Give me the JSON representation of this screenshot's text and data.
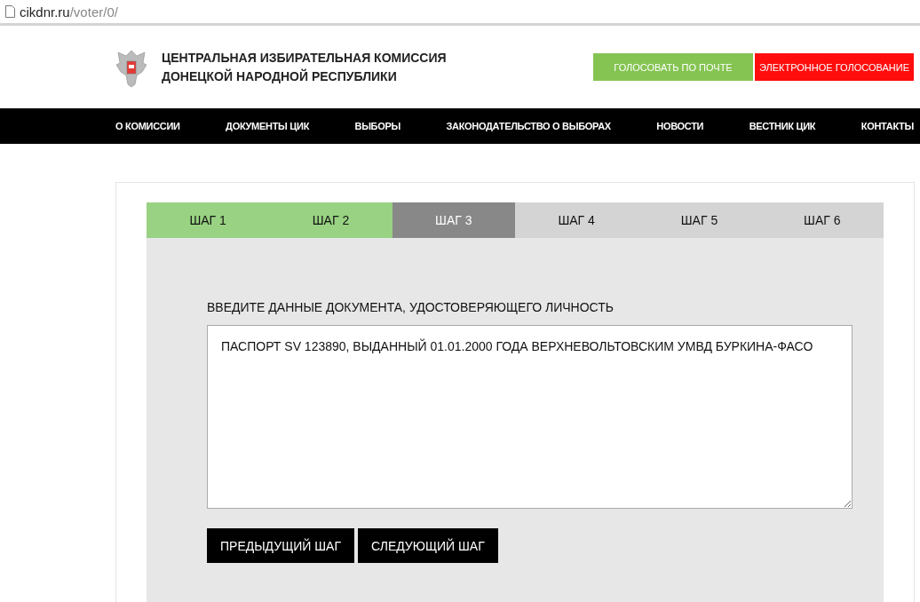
{
  "address_bar": {
    "domain": "cikdnr.ru",
    "path": "/voter/0/"
  },
  "header": {
    "title_lines": [
      "ЦЕНТРАЛЬНАЯ ИЗБИРАТЕЛЬНАЯ КОМИССИЯ",
      "ДОНЕЦКОЙ НАРОДНОЙ РЕСПУБЛИКИ"
    ],
    "buttons": [
      {
        "label": "ГОЛОСОВАТЬ ПО ПОЧТЕ",
        "kind": "mail"
      },
      {
        "label": "ЭЛЕКТРОННОЕ ГОЛОСОВАНИЕ",
        "kind": "electronic"
      }
    ]
  },
  "nav": [
    "О КОМИССИИ",
    "ДОКУМЕНТЫ ЦИК",
    "ВЫБОРЫ",
    "ЗАКОНОДАТЕЛЬСТВО О ВЫБОРАХ",
    "НОВОСТИ",
    "ВЕСТНИК ЦИК",
    "КОНТАКТЫ"
  ],
  "steps": [
    {
      "label": "ШАГ 1",
      "completed": true,
      "selected": false
    },
    {
      "label": "ШАГ 2",
      "completed": true,
      "selected": false
    },
    {
      "label": "ШАГ 3",
      "completed": false,
      "selected": true
    },
    {
      "label": "ШАГ 4",
      "completed": false,
      "selected": false
    },
    {
      "label": "ШАГ 5",
      "completed": false,
      "selected": false
    },
    {
      "label": "ШАГ 6",
      "completed": false,
      "selected": false
    }
  ],
  "form": {
    "label": "ВВЕДИТЕ ДАННЫЕ ДОКУМЕНТА, УДОСТОВЕРЯЮЩЕГО ЛИЧНОСТЬ",
    "value": "ПАСПОРТ SV 123890, ВЫДАННЫЙ 01.01.2000 ГОДА ВЕРХНЕВОЛЬТОВСКИМ УМВД БУРКИНА-ФАСО"
  },
  "actions": [
    "ПРЕДЫДУЩИЙ ШАГ",
    "СЛЕДУЮЩИЙ ШАГ"
  ]
}
